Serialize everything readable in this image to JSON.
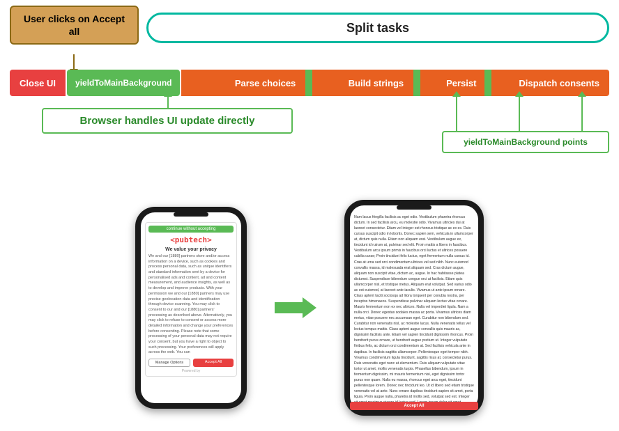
{
  "diagram": {
    "user_clicks_label": "User clicks on Accept all",
    "split_tasks_label": "Split tasks",
    "pipeline": {
      "close_ui": "Close UI",
      "yield1": "yieldToMainBackground",
      "parse_choices": "Parse choices",
      "build_strings": "Build strings",
      "persist": "Persist",
      "dispatch_consents": "Dispatch consents"
    },
    "browser_box": "Browser handles UI update directly",
    "yield_points": "yieldToMainBackground points"
  },
  "phone1": {
    "continue_label": "continue without accepting",
    "logo": "<pubtech>",
    "title": "We value your privacy",
    "body": "We and our [1880] partners store and/or access information on a device, such as cookies and process personal data, such as unique identifiers and standard information sent by a device for personalised ads and content, ad and content measurement, and audience insights, as well as to develop and improve products. With your permission we and our [1880] partners may use precise geolocation data and identification through device scanning. You may click to consent to our and our [1880] partners' processing as described above. Alternatively, you may click to refuse to consent or access more detailed information and change your preferences before consenting. Please note that some processing of your personal data may not require your consent, but you have a right to object to such processing. Your preferences will apply across the web. You can",
    "manage_label": "Manage Options",
    "accept_label": "Accept All",
    "powered_by": "Powered by"
  },
  "phone2": {
    "text": "Nam lacus fringilla facilisis ac eget odio. Vestibulum pharetra rhoncus dictum. In sed facilisis arcu, eu molestie odio. Vivamus ultricies dui at laoreet consectetur. Etiam vel integer est rhoncus tristique ac ex ex. Duis cursus suscipit odio in lobortis. Donec sapien sem, vehicula in ullamcorper at, dictum quis nulla. Etiam non aliquam erat. Vestibulum augue ex, tincidunt id rutrum at, pulvinar sed elit. Proin mattis a libero in faucibus. Vestibulum arcu ipsum primis in faucibus orci luctus et ultrices posuere cubilia curae; Proin tincidunt felis luctus, eget fermentum nulla cursus id. Cras at urna sed orci condimentum ultrices vel sed nibh. Nunc euismod convallis massa, id malesuada erat aliquam sed. Cras dictum augue, aliquam non suscipit vitae, dictum ac, augue. In hac habitasse platea dictumst. Suspendisse bibendum congue orci at facilisis. Etiam quis ullamcorper nisl, et tristique metus. Aliquam erat volutpat. Sed varius odio ac est euismod, at laoreet ante iaculis. Vivamus ut ante ipsum ornare. Class aptent taciti sociosqu ad litora torquent per conubia nostra, per inceptos himenaeos. Suspendisse pulvinar aliquam lectus vitae ornare. Mauris fermentum non ex nec ultrices. Nulla vel imperdiet ligula. Nam a nulla orci. Donec egestas sodales massa ac porta. Vivamus ultrices diam metus, vitae posuere nec accumsan eget. Curabitur non bibendum sed. Curabitur non venenatis nisl, ac molestie lacus. Nulla venenatis tellus vel lectus tempus mattis. Class aptent augue convallis quis mauris ac, dignissim facilisis ante. Etiam vel sapien tincidunt dignissim rhoncus. Proin hendrerit purus ornare, ut hendrerit augue pretium ut. Integer vulputate finibus felis, ac dictum orci condimentum at. Sed facilisis vehicula ante in dapibus. In facilisis sagittis ullamcorper. Pellentesque eget tempor nibh. Vivamus condimentum ligula tincidunt, sagittis risus at, consectetur purus. Duis venenatis eget nunc at elementum. Duis aliquam vulputate vitae tortor ut amet, mollis venenatis turpis. Phasellus bibendum, ipsum in fermentum dignissim, mi mauris fermentum nisi, eget dignissim tortor purus non quam. Nulla eu massa, rhoncus eget arcu eget, tincidunt pellentesque lorem. Donec nec tincidunt leo. Ut id libero sed etiam tristique venenatis vel at ante. Nunc ornare dapibus tincidunt sapien sit amet, porta ligula. Proin augue nulla, pharetra id mollis sed, volutpat sed est. Integer sit amet maximus viverra id lectus sed. Lorem ipsum dolor sit amet, consectetur adipiscing elit. Aliquam a enim vel nibh sodales mattis non eleifend felis. Sed id tellus nec",
    "accept_bar": "Accept All"
  },
  "colors": {
    "orange": "#d4a056",
    "teal": "#00b8a0",
    "red": "#e84040",
    "green": "#5aba55",
    "dark_orange": "#e86020",
    "green_text": "#2a8a2a"
  }
}
